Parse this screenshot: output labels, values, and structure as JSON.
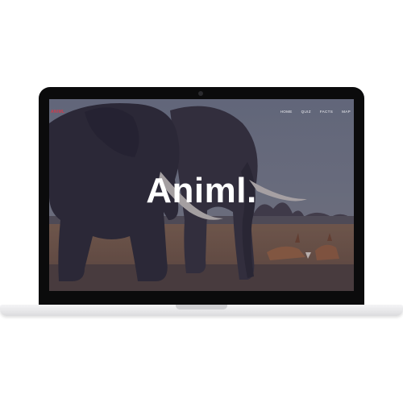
{
  "site": {
    "logo": "ANIML",
    "nav": [
      "HOME",
      "QUIZ",
      "FACTS",
      "MAP"
    ],
    "hero_title": "Animl."
  },
  "colors": {
    "accent": "#d23a4a",
    "bezel": "#0b0b0c",
    "overlay": "#23203a"
  },
  "hero_image": "elephants-and-antelopes-savanna"
}
